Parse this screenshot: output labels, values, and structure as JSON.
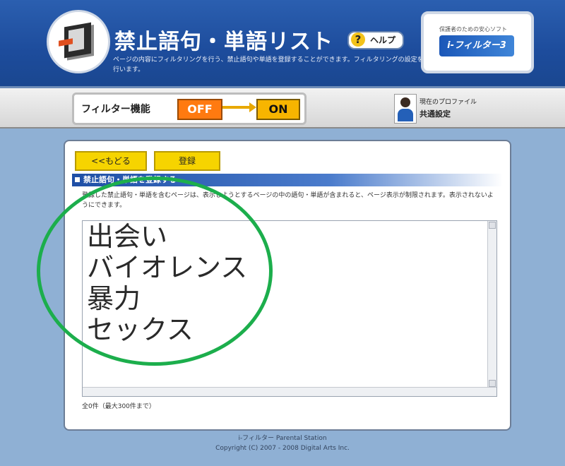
{
  "header": {
    "title": "禁止語句・単語リスト",
    "subtitle": "ページの内容にフィルタリングを行う、禁止語句や単語を登録することができます。フィルタリングの設定を行います。",
    "help_label": "ヘルプ",
    "help_glyph": "?",
    "brand_tagline": "保護者のための安心ソフト",
    "brand_logo": "i-フィルター3"
  },
  "toolbar": {
    "filter_label": "フィルター機能",
    "off_label": "OFF",
    "on_label": "ON",
    "user_line1": "現在のプロファイル",
    "user_line2": "共通設定"
  },
  "panel": {
    "back_label": "<<もどる",
    "save_label": "登録",
    "section_title": "禁止語句・単語を登録する",
    "description": "登録した禁止語句・単語を含むページは、表示しようとするページの中の語句・単語が含まれると、ページ表示が制限されます。表示されないようにできます。",
    "words": [
      "出会い",
      "バイオレンス",
      "暴力",
      "セックス"
    ],
    "count_text": "全0件（最大300件まで）"
  },
  "footer": {
    "line1": "i-フィルター Parental Station",
    "line2": "Copyright (C) 2007 - 2008 Digital Arts Inc."
  },
  "colors": {
    "header_blue": "#1d4c9c",
    "off_orange": "#ff7a10",
    "on_yellow": "#f7b500",
    "button_yellow": "#f6d400",
    "highlight_green": "#1cae4c"
  }
}
